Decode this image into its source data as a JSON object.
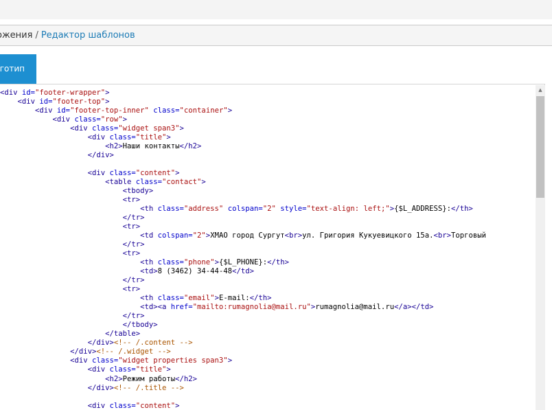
{
  "breadcrumb": {
    "prev": "ожения",
    "separator": "/",
    "current": "Редактор шаблонов"
  },
  "tabs": {
    "logo_label": "Логотип"
  },
  "colors": {
    "tab_active": "#1d8fd1",
    "link": "#1a7ab5",
    "tag": "#170095",
    "attribute": "#0000cc",
    "string": "#aa1111",
    "comment": "#aa5500"
  },
  "editor": {
    "lines": [
      [
        [
          "t",
          "<div "
        ],
        [
          "a",
          "id="
        ],
        [
          "s",
          "\"footer-wrapper\""
        ],
        [
          "t",
          ">"
        ]
      ],
      [
        [
          "p",
          "    "
        ],
        [
          "t",
          "<div "
        ],
        [
          "a",
          "id="
        ],
        [
          "s",
          "\"footer-top\""
        ],
        [
          "t",
          ">"
        ]
      ],
      [
        [
          "p",
          "        "
        ],
        [
          "t",
          "<div "
        ],
        [
          "a",
          "id="
        ],
        [
          "s",
          "\"footer-top-inner\""
        ],
        [
          "p",
          " "
        ],
        [
          "a",
          "class="
        ],
        [
          "s",
          "\"container\""
        ],
        [
          "t",
          ">"
        ]
      ],
      [
        [
          "p",
          "            "
        ],
        [
          "t",
          "<div "
        ],
        [
          "a",
          "class="
        ],
        [
          "s",
          "\"row\""
        ],
        [
          "t",
          ">"
        ]
      ],
      [
        [
          "p",
          "                "
        ],
        [
          "t",
          "<div "
        ],
        [
          "a",
          "class="
        ],
        [
          "s",
          "\"widget span3\""
        ],
        [
          "t",
          ">"
        ]
      ],
      [
        [
          "p",
          "                    "
        ],
        [
          "t",
          "<div "
        ],
        [
          "a",
          "class="
        ],
        [
          "s",
          "\"title\""
        ],
        [
          "t",
          ">"
        ]
      ],
      [
        [
          "p",
          "                        "
        ],
        [
          "t",
          "<h2>"
        ],
        [
          "p",
          "Наши контакты"
        ],
        [
          "t",
          "</h2>"
        ]
      ],
      [
        [
          "p",
          "                    "
        ],
        [
          "t",
          "</div>"
        ]
      ],
      [
        [
          "p",
          ""
        ]
      ],
      [
        [
          "p",
          "                    "
        ],
        [
          "t",
          "<div "
        ],
        [
          "a",
          "class="
        ],
        [
          "s",
          "\"content\""
        ],
        [
          "t",
          ">"
        ]
      ],
      [
        [
          "p",
          "                        "
        ],
        [
          "t",
          "<table "
        ],
        [
          "a",
          "class="
        ],
        [
          "s",
          "\"contact\""
        ],
        [
          "t",
          ">"
        ]
      ],
      [
        [
          "p",
          "                            "
        ],
        [
          "t",
          "<tbody>"
        ]
      ],
      [
        [
          "p",
          "                            "
        ],
        [
          "t",
          "<tr>"
        ]
      ],
      [
        [
          "p",
          "                                "
        ],
        [
          "t",
          "<th "
        ],
        [
          "a",
          "class="
        ],
        [
          "s",
          "\"address\""
        ],
        [
          "p",
          " "
        ],
        [
          "a",
          "colspan="
        ],
        [
          "s",
          "\"2\""
        ],
        [
          "p",
          " "
        ],
        [
          "a",
          "style="
        ],
        [
          "s",
          "\"text-align: left;\""
        ],
        [
          "t",
          ">"
        ],
        [
          "p",
          "{$L_ADDRESS}:"
        ],
        [
          "t",
          "</th>"
        ]
      ],
      [
        [
          "p",
          "                            "
        ],
        [
          "t",
          "</tr>"
        ]
      ],
      [
        [
          "p",
          "                            "
        ],
        [
          "t",
          "<tr>"
        ]
      ],
      [
        [
          "p",
          "                                "
        ],
        [
          "t",
          "<td "
        ],
        [
          "a",
          "colspan="
        ],
        [
          "s",
          "\"2\""
        ],
        [
          "t",
          ">"
        ],
        [
          "p",
          "ХМАО город Сургут"
        ],
        [
          "t",
          "<br>"
        ],
        [
          "p",
          "ул. Григория Кукуевицкого 15а."
        ],
        [
          "t",
          "<br>"
        ],
        [
          "p",
          "Торговый"
        ]
      ],
      [
        [
          "p",
          "                            "
        ],
        [
          "t",
          "</tr>"
        ]
      ],
      [
        [
          "p",
          "                            "
        ],
        [
          "t",
          "<tr>"
        ]
      ],
      [
        [
          "p",
          "                                "
        ],
        [
          "t",
          "<th "
        ],
        [
          "a",
          "class="
        ],
        [
          "s",
          "\"phone\""
        ],
        [
          "t",
          ">"
        ],
        [
          "p",
          "{$L_PHONE}:"
        ],
        [
          "t",
          "</th>"
        ]
      ],
      [
        [
          "p",
          "                                "
        ],
        [
          "t",
          "<td>"
        ],
        [
          "p",
          "8 (3462) 34-44-48"
        ],
        [
          "t",
          "</td>"
        ]
      ],
      [
        [
          "p",
          "                            "
        ],
        [
          "t",
          "</tr>"
        ]
      ],
      [
        [
          "p",
          "                            "
        ],
        [
          "t",
          "<tr>"
        ]
      ],
      [
        [
          "p",
          "                                "
        ],
        [
          "t",
          "<th "
        ],
        [
          "a",
          "class="
        ],
        [
          "s",
          "\"email\""
        ],
        [
          "t",
          ">"
        ],
        [
          "p",
          "E-mail:"
        ],
        [
          "t",
          "</th>"
        ]
      ],
      [
        [
          "p",
          "                                "
        ],
        [
          "t",
          "<td><a "
        ],
        [
          "a",
          "href="
        ],
        [
          "s",
          "\"mailto:rumagnolia@mail.ru\""
        ],
        [
          "t",
          ">"
        ],
        [
          "p",
          "rumagnolia@mail.ru"
        ],
        [
          "t",
          "</a></td>"
        ]
      ],
      [
        [
          "p",
          "                            "
        ],
        [
          "t",
          "</tr>"
        ]
      ],
      [
        [
          "p",
          "                            "
        ],
        [
          "t",
          "</tbody>"
        ]
      ],
      [
        [
          "p",
          "                        "
        ],
        [
          "t",
          "</table>"
        ]
      ],
      [
        [
          "p",
          "                    "
        ],
        [
          "t",
          "</div>"
        ],
        [
          "c",
          "<!-- /.content -->"
        ]
      ],
      [
        [
          "p",
          "                "
        ],
        [
          "t",
          "</div>"
        ],
        [
          "c",
          "<!-- /.widget -->"
        ]
      ],
      [
        [
          "p",
          "                "
        ],
        [
          "t",
          "<div "
        ],
        [
          "a",
          "class="
        ],
        [
          "s",
          "\"widget properties span3\""
        ],
        [
          "t",
          ">"
        ]
      ],
      [
        [
          "p",
          "                    "
        ],
        [
          "t",
          "<div "
        ],
        [
          "a",
          "class="
        ],
        [
          "s",
          "\"title\""
        ],
        [
          "t",
          ">"
        ]
      ],
      [
        [
          "p",
          "                        "
        ],
        [
          "t",
          "<h2>"
        ],
        [
          "p",
          "Режим работы"
        ],
        [
          "t",
          "</h2>"
        ]
      ],
      [
        [
          "p",
          "                    "
        ],
        [
          "t",
          "</div>"
        ],
        [
          "c",
          "<!-- /.title -->"
        ]
      ],
      [
        [
          "p",
          ""
        ]
      ],
      [
        [
          "p",
          "                    "
        ],
        [
          "t",
          "<div "
        ],
        [
          "a",
          "class="
        ],
        [
          "s",
          "\"content\""
        ],
        [
          "t",
          ">"
        ]
      ]
    ]
  }
}
